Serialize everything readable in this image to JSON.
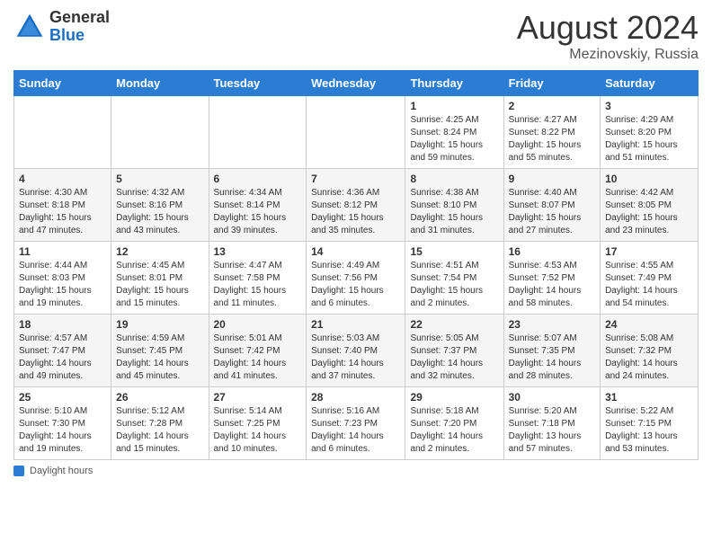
{
  "header": {
    "logo_general": "General",
    "logo_blue": "Blue",
    "month_year": "August 2024",
    "location": "Mezinovskiy, Russia"
  },
  "footer": {
    "daylight_label": "Daylight hours"
  },
  "weekdays": [
    "Sunday",
    "Monday",
    "Tuesday",
    "Wednesday",
    "Thursday",
    "Friday",
    "Saturday"
  ],
  "weeks": [
    [
      {
        "day": "",
        "info": ""
      },
      {
        "day": "",
        "info": ""
      },
      {
        "day": "",
        "info": ""
      },
      {
        "day": "",
        "info": ""
      },
      {
        "day": "1",
        "info": "Sunrise: 4:25 AM\nSunset: 8:24 PM\nDaylight: 15 hours\nand 59 minutes."
      },
      {
        "day": "2",
        "info": "Sunrise: 4:27 AM\nSunset: 8:22 PM\nDaylight: 15 hours\nand 55 minutes."
      },
      {
        "day": "3",
        "info": "Sunrise: 4:29 AM\nSunset: 8:20 PM\nDaylight: 15 hours\nand 51 minutes."
      }
    ],
    [
      {
        "day": "4",
        "info": "Sunrise: 4:30 AM\nSunset: 8:18 PM\nDaylight: 15 hours\nand 47 minutes."
      },
      {
        "day": "5",
        "info": "Sunrise: 4:32 AM\nSunset: 8:16 PM\nDaylight: 15 hours\nand 43 minutes."
      },
      {
        "day": "6",
        "info": "Sunrise: 4:34 AM\nSunset: 8:14 PM\nDaylight: 15 hours\nand 39 minutes."
      },
      {
        "day": "7",
        "info": "Sunrise: 4:36 AM\nSunset: 8:12 PM\nDaylight: 15 hours\nand 35 minutes."
      },
      {
        "day": "8",
        "info": "Sunrise: 4:38 AM\nSunset: 8:10 PM\nDaylight: 15 hours\nand 31 minutes."
      },
      {
        "day": "9",
        "info": "Sunrise: 4:40 AM\nSunset: 8:07 PM\nDaylight: 15 hours\nand 27 minutes."
      },
      {
        "day": "10",
        "info": "Sunrise: 4:42 AM\nSunset: 8:05 PM\nDaylight: 15 hours\nand 23 minutes."
      }
    ],
    [
      {
        "day": "11",
        "info": "Sunrise: 4:44 AM\nSunset: 8:03 PM\nDaylight: 15 hours\nand 19 minutes."
      },
      {
        "day": "12",
        "info": "Sunrise: 4:45 AM\nSunset: 8:01 PM\nDaylight: 15 hours\nand 15 minutes."
      },
      {
        "day": "13",
        "info": "Sunrise: 4:47 AM\nSunset: 7:58 PM\nDaylight: 15 hours\nand 11 minutes."
      },
      {
        "day": "14",
        "info": "Sunrise: 4:49 AM\nSunset: 7:56 PM\nDaylight: 15 hours\nand 6 minutes."
      },
      {
        "day": "15",
        "info": "Sunrise: 4:51 AM\nSunset: 7:54 PM\nDaylight: 15 hours\nand 2 minutes."
      },
      {
        "day": "16",
        "info": "Sunrise: 4:53 AM\nSunset: 7:52 PM\nDaylight: 14 hours\nand 58 minutes."
      },
      {
        "day": "17",
        "info": "Sunrise: 4:55 AM\nSunset: 7:49 PM\nDaylight: 14 hours\nand 54 minutes."
      }
    ],
    [
      {
        "day": "18",
        "info": "Sunrise: 4:57 AM\nSunset: 7:47 PM\nDaylight: 14 hours\nand 49 minutes."
      },
      {
        "day": "19",
        "info": "Sunrise: 4:59 AM\nSunset: 7:45 PM\nDaylight: 14 hours\nand 45 minutes."
      },
      {
        "day": "20",
        "info": "Sunrise: 5:01 AM\nSunset: 7:42 PM\nDaylight: 14 hours\nand 41 minutes."
      },
      {
        "day": "21",
        "info": "Sunrise: 5:03 AM\nSunset: 7:40 PM\nDaylight: 14 hours\nand 37 minutes."
      },
      {
        "day": "22",
        "info": "Sunrise: 5:05 AM\nSunset: 7:37 PM\nDaylight: 14 hours\nand 32 minutes."
      },
      {
        "day": "23",
        "info": "Sunrise: 5:07 AM\nSunset: 7:35 PM\nDaylight: 14 hours\nand 28 minutes."
      },
      {
        "day": "24",
        "info": "Sunrise: 5:08 AM\nSunset: 7:32 PM\nDaylight: 14 hours\nand 24 minutes."
      }
    ],
    [
      {
        "day": "25",
        "info": "Sunrise: 5:10 AM\nSunset: 7:30 PM\nDaylight: 14 hours\nand 19 minutes."
      },
      {
        "day": "26",
        "info": "Sunrise: 5:12 AM\nSunset: 7:28 PM\nDaylight: 14 hours\nand 15 minutes."
      },
      {
        "day": "27",
        "info": "Sunrise: 5:14 AM\nSunset: 7:25 PM\nDaylight: 14 hours\nand 10 minutes."
      },
      {
        "day": "28",
        "info": "Sunrise: 5:16 AM\nSunset: 7:23 PM\nDaylight: 14 hours\nand 6 minutes."
      },
      {
        "day": "29",
        "info": "Sunrise: 5:18 AM\nSunset: 7:20 PM\nDaylight: 14 hours\nand 2 minutes."
      },
      {
        "day": "30",
        "info": "Sunrise: 5:20 AM\nSunset: 7:18 PM\nDaylight: 13 hours\nand 57 minutes."
      },
      {
        "day": "31",
        "info": "Sunrise: 5:22 AM\nSunset: 7:15 PM\nDaylight: 13 hours\nand 53 minutes."
      }
    ]
  ]
}
